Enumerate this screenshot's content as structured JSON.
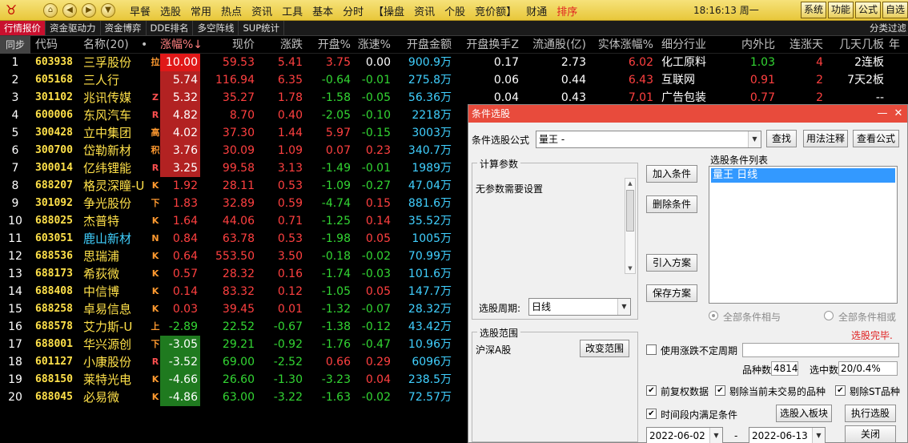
{
  "menu": [
    "早餐",
    "选股",
    "常用",
    "热点",
    "资讯",
    "工具",
    "基本",
    "分时",
    "【操盘",
    "资讯",
    "个股",
    "竞价额】",
    "财通",
    "排序"
  ],
  "clock": "18:16:13 周一",
  "right_buttons": [
    "系统",
    "功能",
    "公式",
    "自选"
  ],
  "tabs": [
    "行情报价",
    "资金驱动力",
    "资金博弈",
    "DDE排名",
    "多空阵线",
    "SUP统计"
  ],
  "tab_right": "分类过滤",
  "headers": [
    "同步",
    "代码",
    "名称(20)",
    "•",
    "涨幅%↓",
    "现价",
    "涨跌",
    "开盘%",
    "涨速%",
    "开盘金额",
    "开盘换手Z",
    "流通股(亿)",
    "实体涨幅%",
    "细分行业",
    "内外比",
    "连涨天",
    "几天几板",
    "年"
  ],
  "rows": [
    {
      "idx": "1",
      "code": "603938",
      "name": "三孚股份",
      "flag": "拉",
      "pct": "10.00",
      "price": "59.53",
      "chg": "5.41",
      "open_pct": "3.75",
      "speed": "0.00",
      "open_amt": "900.9万",
      "turnover": "0.17",
      "float": "2.73",
      "body_pct": "6.02",
      "industry": "化工原料",
      "ratio": "1.03",
      "days": "4",
      "boards": "2连板"
    },
    {
      "idx": "2",
      "code": "605168",
      "name": "三人行",
      "flag": "",
      "pct": "5.74",
      "price": "116.94",
      "chg": "6.35",
      "open_pct": "-0.64",
      "speed": "-0.01",
      "open_amt": "275.8万",
      "turnover": "0.06",
      "float": "0.44",
      "body_pct": "6.43",
      "industry": "互联网",
      "ratio": "0.91",
      "days": "2",
      "boards": "7天2板"
    },
    {
      "idx": "3",
      "code": "301102",
      "name": "兆讯传媒",
      "flag": "Z",
      "pct": "5.32",
      "price": "35.27",
      "chg": "1.78",
      "open_pct": "-1.58",
      "speed": "-0.05",
      "open_amt": "56.36万",
      "turnover": "0.04",
      "float": "0.43",
      "body_pct": "7.01",
      "industry": "广告包装",
      "ratio": "0.77",
      "days": "2",
      "boards": "--"
    },
    {
      "idx": "4",
      "code": "600006",
      "name": "东风汽车",
      "flag": "R",
      "pct": "4.82",
      "price": "8.70",
      "chg": "0.40",
      "open_pct": "-2.05",
      "speed": "-0.10",
      "open_amt": "2218万"
    },
    {
      "idx": "5",
      "code": "300428",
      "name": "立中集团",
      "flag": "高",
      "pct": "4.02",
      "price": "37.30",
      "chg": "1.44",
      "open_pct": "5.97",
      "speed": "-0.15",
      "open_amt": "3003万"
    },
    {
      "idx": "6",
      "code": "300700",
      "name": "岱勒新材",
      "flag": "积",
      "pct": "3.76",
      "price": "30.09",
      "chg": "1.09",
      "open_pct": "0.07",
      "speed": "0.23",
      "open_amt": "340.7万"
    },
    {
      "idx": "7",
      "code": "300014",
      "name": "亿纬锂能",
      "flag": "R",
      "pct": "3.25",
      "price": "99.58",
      "chg": "3.13",
      "open_pct": "-1.49",
      "speed": "-0.01",
      "open_amt": "1989万"
    },
    {
      "idx": "8",
      "code": "688207",
      "name": "格灵深瞳-U",
      "flag": "K",
      "pct": "1.92",
      "price": "28.11",
      "chg": "0.53",
      "open_pct": "-1.09",
      "speed": "-0.27",
      "open_amt": "47.04万"
    },
    {
      "idx": "9",
      "code": "301092",
      "name": "争光股份",
      "flag": "下",
      "pct": "1.83",
      "price": "32.89",
      "chg": "0.59",
      "open_pct": "-4.74",
      "speed": "0.15",
      "open_amt": "881.6万"
    },
    {
      "idx": "10",
      "code": "688025",
      "name": "杰普特",
      "flag": "K",
      "pct": "1.64",
      "price": "44.06",
      "chg": "0.71",
      "open_pct": "-1.25",
      "speed": "0.14",
      "open_amt": "35.52万"
    },
    {
      "idx": "11",
      "code": "603051",
      "name": "鹿山新材",
      "flag": "N",
      "pct": "0.84",
      "price": "63.78",
      "chg": "0.53",
      "open_pct": "-1.98",
      "speed": "0.05",
      "open_amt": "1005万"
    },
    {
      "idx": "12",
      "code": "688536",
      "name": "思瑞浦",
      "flag": "K",
      "pct": "0.64",
      "price": "553.50",
      "chg": "3.50",
      "open_pct": "-0.18",
      "speed": "-0.02",
      "open_amt": "70.99万"
    },
    {
      "idx": "13",
      "code": "688173",
      "name": "希荻微",
      "flag": "K",
      "pct": "0.57",
      "price": "28.32",
      "chg": "0.16",
      "open_pct": "-1.74",
      "speed": "-0.03",
      "open_amt": "101.6万"
    },
    {
      "idx": "14",
      "code": "688408",
      "name": "中信博",
      "flag": "K",
      "pct": "0.14",
      "price": "83.32",
      "chg": "0.12",
      "open_pct": "-1.05",
      "speed": "0.05",
      "open_amt": "147.7万"
    },
    {
      "idx": "15",
      "code": "688258",
      "name": "卓易信息",
      "flag": "K",
      "pct": "0.03",
      "price": "39.45",
      "chg": "0.01",
      "open_pct": "-1.32",
      "speed": "-0.07",
      "open_amt": "28.32万"
    },
    {
      "idx": "16",
      "code": "688578",
      "name": "艾力斯-U",
      "flag": "上",
      "pct": "-2.89",
      "price": "22.52",
      "chg": "-0.67",
      "open_pct": "-1.38",
      "speed": "-0.12",
      "open_amt": "43.42万"
    },
    {
      "idx": "17",
      "code": "688001",
      "name": "华兴源创",
      "flag": "下",
      "pct": "-3.05",
      "price": "29.21",
      "chg": "-0.92",
      "open_pct": "-1.76",
      "speed": "-0.47",
      "open_amt": "10.96万"
    },
    {
      "idx": "18",
      "code": "601127",
      "name": "小康股份",
      "flag": "R",
      "pct": "-3.52",
      "price": "69.00",
      "chg": "-2.52",
      "open_pct": "0.66",
      "speed": "0.29",
      "open_amt": "6096万"
    },
    {
      "idx": "19",
      "code": "688150",
      "name": "莱特光电",
      "flag": "K",
      "pct": "-4.66",
      "price": "26.60",
      "chg": "-1.30",
      "open_pct": "-3.23",
      "speed": "0.04",
      "open_amt": "238.5万"
    },
    {
      "idx": "20",
      "code": "688045",
      "name": "必易微",
      "flag": "K",
      "pct": "-4.86",
      "price": "63.00",
      "chg": "-3.22",
      "open_pct": "-1.63",
      "speed": "-0.02",
      "open_amt": "72.57万"
    }
  ],
  "dialog": {
    "title": "条件选股",
    "formula_label": "条件选股公式",
    "formula_value": "量王         -",
    "find_btn": "查找",
    "usage_btn": "用法注释",
    "view_btn": "查看公式",
    "params_title": "计算参数",
    "params_text": "无参数需要设置",
    "add_btn": "加入条件",
    "del_btn": "删除条件",
    "import_btn": "引入方案",
    "save_btn": "保存方案",
    "list_title": "选股条件列表",
    "list_item": "量王  日线",
    "period_label": "选股周期:",
    "period_value": "日线",
    "radio_all_and": "全部条件相与",
    "radio_all_or": "全部条件相或",
    "status": "选股完毕.",
    "range_title": "选股范围",
    "range_value": "沪深A股",
    "change_range_btn": "改变范围",
    "use_uncertain": "使用涨跌不定周期",
    "count_label": "品种数",
    "count_value": "4814",
    "selected_label": "选中数",
    "selected_value": "20/0.4%",
    "chk_restore": "前复权数据",
    "chk_exclude_suspended": "剔除当前未交易的品种",
    "chk_exclude_st": "剔除ST品种",
    "chk_period": "时间段内满足条件",
    "to_board_btn": "选股入板块",
    "run_btn": "执行选股",
    "date_from": "2022-06-02",
    "date_sep": "-",
    "date_to": "2022-06-13",
    "close_btn": "关闭"
  },
  "colors": {
    "up": "#ff4040",
    "down": "#33d633",
    "code": "#ffe14a",
    "title_red": "#e84b3c",
    "menu_gold": "#e8c73a"
  }
}
